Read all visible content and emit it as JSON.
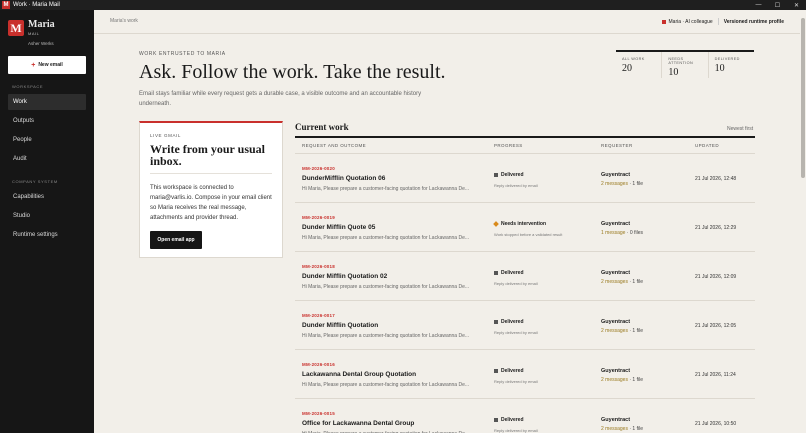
{
  "window": {
    "title": "Work · Maria Mail",
    "logo_letter": "M",
    "minimize": "—",
    "maximize": "☐",
    "close": "✕"
  },
  "brand": {
    "logo_letter": "M",
    "name": "Maria",
    "sub": "MAIL",
    "user": "Asher Werks"
  },
  "sidebar": {
    "new_email": "New email",
    "workspace_label": "WORKSPACE",
    "workspace_items": [
      {
        "label": "Work"
      },
      {
        "label": "Outputs"
      },
      {
        "label": "People"
      },
      {
        "label": "Audit"
      }
    ],
    "company_label": "COMPANY SYSTEM",
    "company_items": [
      {
        "label": "Capabilities"
      },
      {
        "label": "Studio"
      },
      {
        "label": "Runtime settings"
      }
    ]
  },
  "topbar": {
    "breadcrumb": "Maria's work",
    "colleagues": "Maria · AI colleague",
    "versioned": "Versioned runtime profile"
  },
  "hero": {
    "eyebrow": "WORK ENTRUSTED TO MARIA",
    "headline": "Ask. Follow the work. Take the result.",
    "intro": "Email stays familiar while every request gets a durable case, a visible outcome and an accountable history underneath."
  },
  "stats": [
    {
      "label": "ALL WORK",
      "value": "20"
    },
    {
      "label": "NEEDS ATTENTION",
      "value": "10"
    },
    {
      "label": "DELIVERED",
      "value": "10"
    }
  ],
  "gmail": {
    "eyebrow": "LIVE GMAIL",
    "title": "Write from your usual inbox.",
    "body": "This workspace is connected to maria@varlis.io. Compose in your email client so Maria receives the real message, attachments and provider thread.",
    "button": "Open email app"
  },
  "current_work": {
    "title": "Current work",
    "sort": "Newest first",
    "columns": [
      "REQUEST AND OUTCOME",
      "PROGRESS",
      "REQUESTER",
      "UPDATED"
    ],
    "rows": [
      {
        "id": "MM-2026-0020",
        "title": "DunderMifflin Quotation 06",
        "snippet": "Hi Maria, Please prepare a customer-facing quotation for Lackawanna De...",
        "status": "Delivered",
        "status_kind": "delivered",
        "note": "Reply delivered by email",
        "requester": "Guyentract",
        "messages": "2 messages",
        "files": "· 1 file",
        "updated": "21 Jul 2026, 12:48"
      },
      {
        "id": "MM-2026-0019",
        "title": "Dunder Mifflin Quote 05",
        "snippet": "Hi Maria, Please prepare a customer-facing quotation for Lackawanna De...",
        "status": "Needs intervention",
        "status_kind": "warn",
        "note": "Work stopped before a validated result",
        "requester": "Guyentract",
        "messages": "1 message",
        "files": "· 0 files",
        "updated": "21 Jul 2026, 12:29"
      },
      {
        "id": "MM-2026-0018",
        "title": "Dunder Mifflin Quotation 02",
        "snippet": "Hi Maria, Please prepare a customer-facing quotation for Lackawanna De...",
        "status": "Delivered",
        "status_kind": "delivered",
        "note": "Reply delivered by email",
        "requester": "Guyentract",
        "messages": "2 messages",
        "files": "· 1 file",
        "updated": "21 Jul 2026, 12:09"
      },
      {
        "id": "MM-2026-0017",
        "title": "Dunder Mifflin Quotation",
        "snippet": "Hi Maria, Please prepare a customer-facing quotation for Lackawanna De...",
        "status": "Delivered",
        "status_kind": "delivered",
        "note": "Reply delivered by email",
        "requester": "Guyentract",
        "messages": "2 messages",
        "files": "· 1 file",
        "updated": "21 Jul 2026, 12:05"
      },
      {
        "id": "MM-2026-0016",
        "title": "Lackawanna Dental Group Quotation",
        "snippet": "Hi Maria, Please prepare a customer-facing quotation for Lackawanna De...",
        "status": "Delivered",
        "status_kind": "delivered",
        "note": "Reply delivered by email",
        "requester": "Guyentract",
        "messages": "2 messages",
        "files": "· 1 file",
        "updated": "21 Jul 2026, 11:24"
      },
      {
        "id": "MM-2026-0015",
        "title": "Office for Lackawanna Dental Group",
        "snippet": "Hi Maria, Please prepare a customer-facing quotation for Lackawanna De...",
        "status": "Delivered",
        "status_kind": "delivered",
        "note": "Reply delivered by email",
        "requester": "Guyentract",
        "messages": "2 messages",
        "files": "· 1 file",
        "updated": "21 Jul 2026, 10:50"
      }
    ]
  },
  "colors": {
    "accent": "#c9302c",
    "sidebar": "#161616",
    "background": "#f2efe9",
    "warning": "#d98a1b"
  }
}
